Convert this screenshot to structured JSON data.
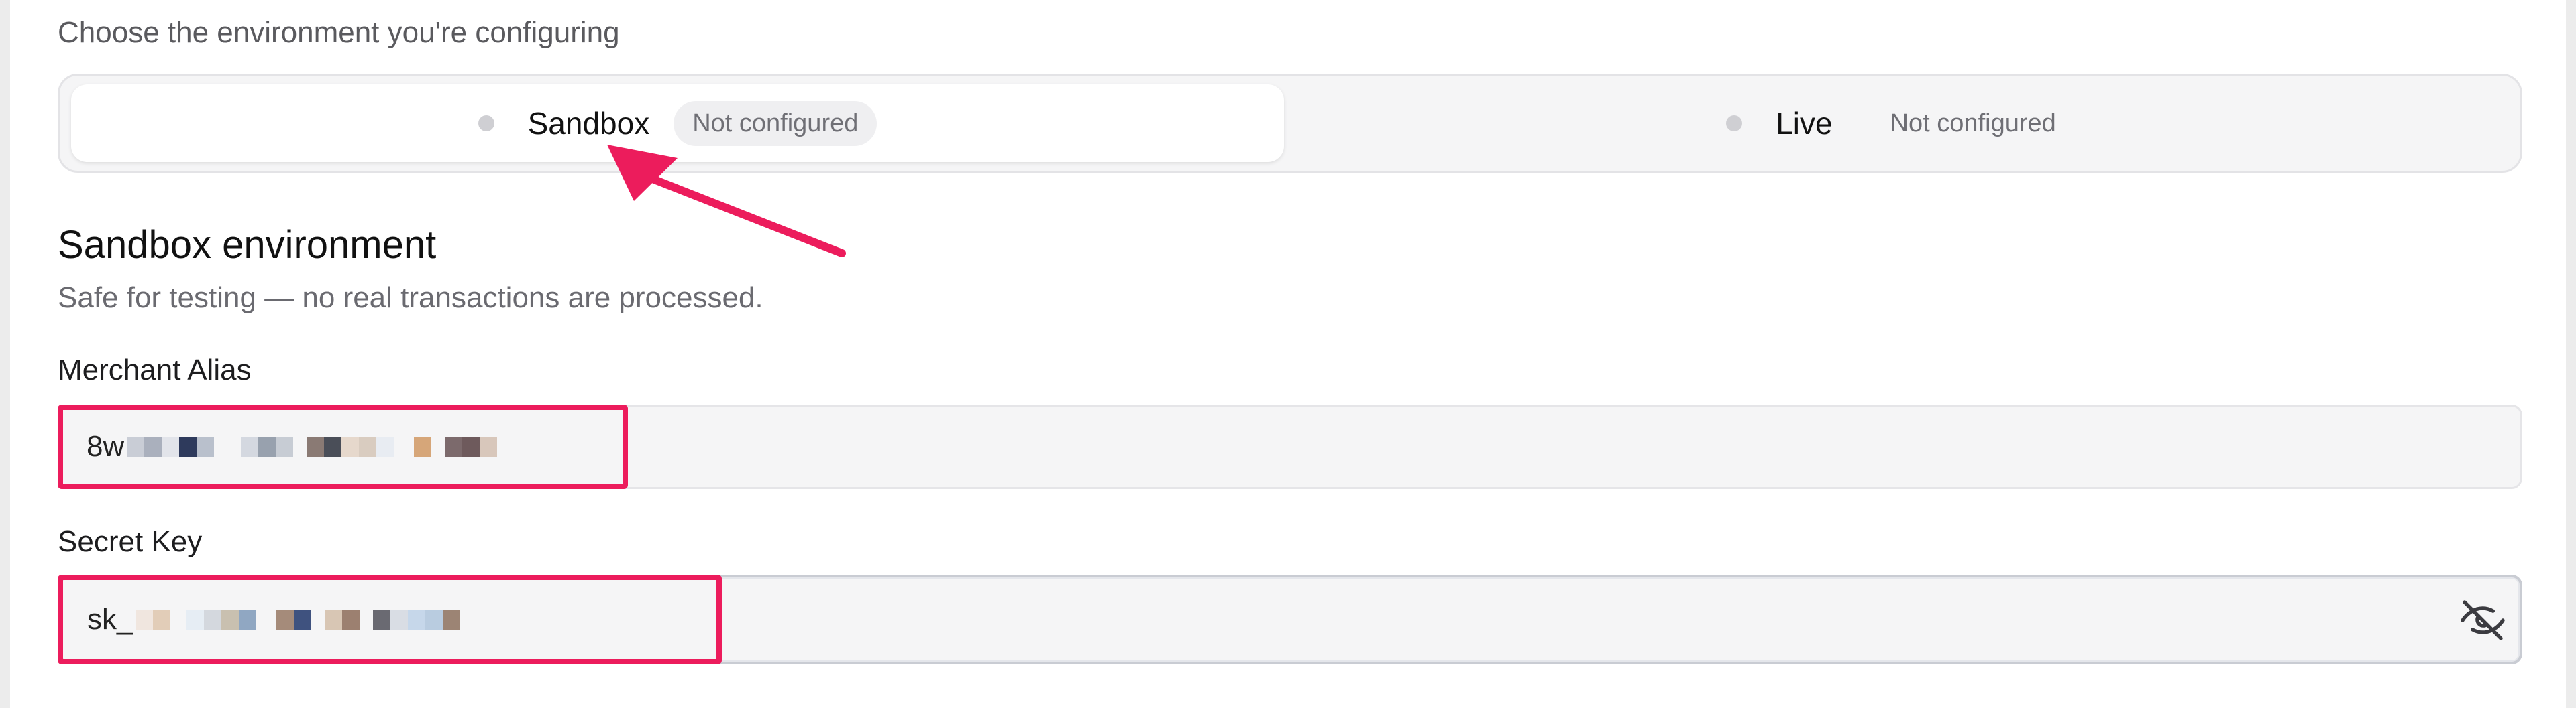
{
  "environment": {
    "prompt": "Choose the environment you're configuring",
    "options": [
      {
        "label": "Sandbox",
        "status": "Not configured",
        "selected": true
      },
      {
        "label": "Live",
        "status": "Not configured",
        "selected": false
      }
    ]
  },
  "section": {
    "title": "Sandbox environment",
    "subtitle": "Safe for testing — no real transactions are processed."
  },
  "fields": {
    "merchant_alias": {
      "label": "Merchant Alias",
      "value_prefix": "8w"
    },
    "secret_key": {
      "label": "Secret Key",
      "value_prefix": "sk_",
      "visibility_icon": "eye-off-icon"
    }
  },
  "colors": {
    "annotation": "#ec1c5c",
    "status_dot": "#cfcfd3"
  }
}
